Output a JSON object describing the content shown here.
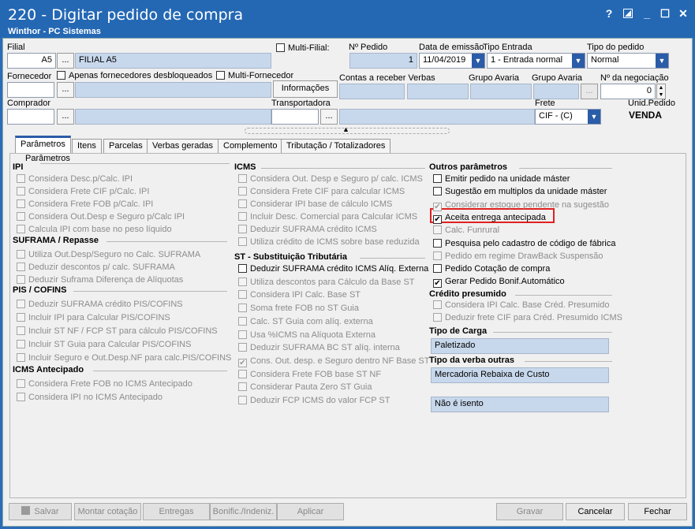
{
  "window": {
    "title": "220 - Digitar pedido de compra",
    "subtitle": "Winthor - PC Sistemas",
    "help": "?",
    "minimize": "_",
    "maximize": "☐",
    "close": "✕"
  },
  "header": {
    "filial_label": "Filial",
    "filial_code": "A5",
    "filial_name": "FILIAL A5",
    "multi_filial_label": "Multi-Filial:",
    "num_pedido_label": "Nº Pedido",
    "num_pedido": "1",
    "data_emissao_label": "Data de emissão",
    "data_emissao": "11/04/2019",
    "tipo_entrada_label": "Tipo Entrada",
    "tipo_entrada": "1 - Entrada normal",
    "tipo_pedido_label": "Tipo do pedido",
    "tipo_pedido": "Normal",
    "fornecedor_label": "Fornecedor",
    "apenas_fornecedores_label": "Apenas fornecedores desbloqueados",
    "multi_fornecedor_label": "Multi-Fornecedor",
    "informacoes_label": "Informações",
    "contas_receber_label": "Contas a receber Verbas",
    "grupo_avaria1_label": "Grupo Avaria",
    "grupo_avaria2_label": "Grupo Avaria",
    "num_negociacao_label": "Nº da negociação",
    "num_negociacao": "0",
    "comprador_label": "Comprador",
    "transportadora_label": "Transportadora",
    "frete_label": "Frete",
    "frete": "CIF - (C)",
    "unid_pedido_label": "Unid.Pedido",
    "unid_pedido": "VENDA",
    "dots": "..."
  },
  "tabs": [
    "Parâmetros",
    "Itens",
    "Parcelas",
    "Verbas geradas",
    "Complemento",
    "Tributação / Totalizadores"
  ],
  "panel": {
    "title": "Parâmetros",
    "ipi": {
      "title": "IPI",
      "items": [
        "Considera Desc.p/Calc. IPI",
        "Considera Frete CIF p/Calc. IPI",
        "Considera Frete FOB p/Calc. IPI",
        "Considera Out.Desp e Seguro p/Calc IPI",
        "Calcula IPI com base no peso líquido"
      ]
    },
    "suframa": {
      "title": "SUFRAMA / Repasse",
      "items": [
        "Utiliza Out.Desp/Seguro no Calc. SUFRAMA",
        "Deduzir descontos p/ calc. SUFRAMA",
        "Deduzir Suframa Diferença de Alíquotas"
      ]
    },
    "pis": {
      "title": "PIS / COFINS",
      "items": [
        "Deduzir SUFRAMA crédito PIS/COFINS",
        "Incluir IPI para Calcular PIS/COFINS",
        "Incluir ST NF / FCP ST para cálculo PIS/COFINS",
        "Incluir ST Guia para Calcular PIS/COFINS",
        "Incluir Seguro e Out.Desp.NF para calc.PIS/COFINS"
      ]
    },
    "icms_ant": {
      "title": "ICMS Antecipado",
      "items": [
        "Considera Frete FOB no ICMS Antecipado",
        "Considera IPI no ICMS Antecipado"
      ]
    },
    "icms": {
      "title": "ICMS",
      "items": [
        "Considera Out. Desp e Seguro p/ calc. ICMS",
        "Considera Frete CIF para calcular ICMS",
        "Considerar IPI base de cálculo ICMS",
        "Incluir Desc. Comercial  para Calcular ICMS",
        "Deduzir SUFRAMA crédito ICMS",
        "Utiliza crédito de ICMS sobre base reduzida"
      ]
    },
    "st": {
      "title": "ST - Substituição Tributária",
      "items": [
        "Deduzir SUFRAMA crédito ICMS Alíq. Externa",
        "Utiliza descontos para Cálculo da Base ST",
        "Considera IPI Calc. Base ST",
        "Soma frete FOB no ST Guia",
        "Calc. ST Guia com alíq. externa",
        "Usa %ICMS na Alíquota Externa",
        "Deduzir SUFRAMA BC ST alíq. interna",
        "Cons. Out. desp. e Seguro dentro NF Base ST",
        "Considera Frete FOB base ST NF",
        "Considerar Pauta Zero ST Guia",
        "Deduzir FCP ICMS do valor FCP ST"
      ]
    },
    "outros": {
      "title": "Outros parâmetros",
      "items": [
        "Emitir pedido na unidade máster",
        "Sugestão em multiplos da unidade máster",
        "Considerar estoque pendente na sugestão",
        "Aceita entrega antecipada",
        "Calc. Funrural",
        "Pesquisa pelo cadastro de código de fábrica",
        "Pedido em regime DrawBack Suspensão",
        "Pedido Cotação de compra",
        "Gerar Pedido Bonif.Automático"
      ]
    },
    "credito": {
      "title": "Crédito presumido",
      "items": [
        "Considera IPI Calc. Base Créd. Presumido",
        "Deduzir frete CIF para Créd. Presumido ICMS"
      ]
    },
    "tipo_carga": {
      "title": "Tipo de Carga",
      "value": "Paletizado"
    },
    "tipo_verba": {
      "title": "Tipo da verba outras",
      "value": "Mercadoria Rebaixa de Custo"
    },
    "isento": "Não é isento"
  },
  "footer": {
    "salvar": "Salvar",
    "montar": "Montar cotação",
    "entregas": "Entregas",
    "bonific": "Bonific./Indeniz.",
    "aplicar": "Aplicar",
    "gravar": "Gravar",
    "cancelar": "Cancelar",
    "fechar": "Fechar"
  },
  "check": "✔",
  "colors": {
    "titlebar": "#2468b4",
    "disabled_field": "#c8d8ec",
    "highlight": "#e02020"
  }
}
